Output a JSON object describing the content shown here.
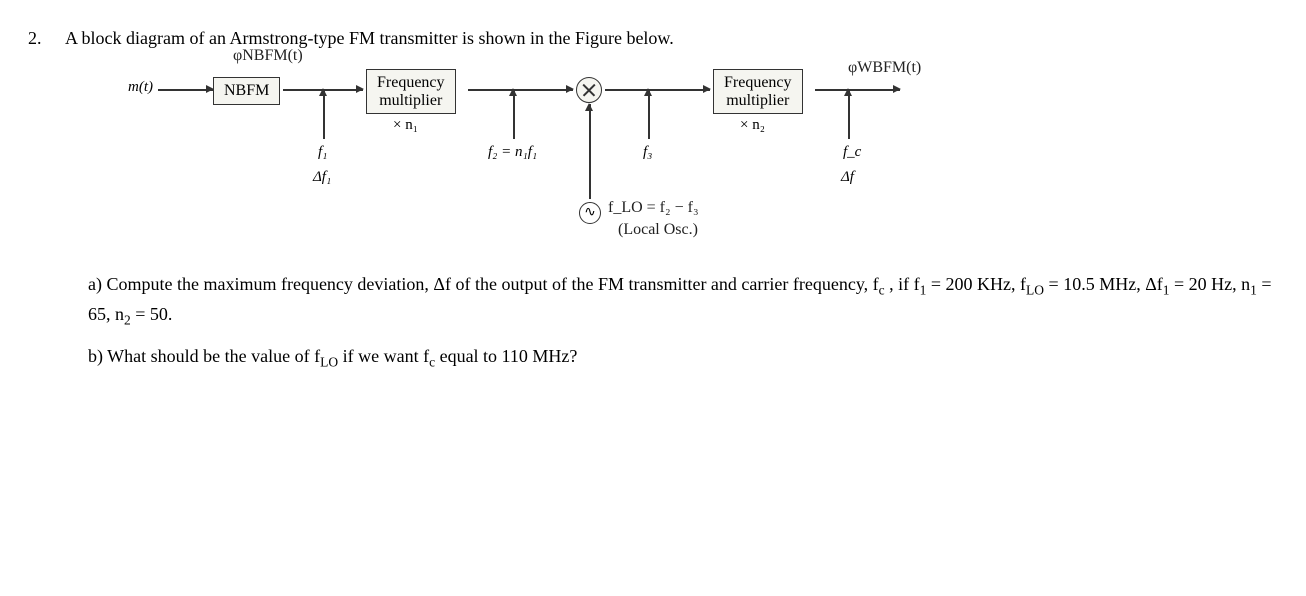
{
  "problem": {
    "number": "2.",
    "statement": "A block diagram of an Armstrong-type FM transmitter is shown in the Figure below."
  },
  "diagram": {
    "input": "m(t)",
    "block_nbfm": "NBFM",
    "hand_nbfm_out": "φNBFM(t)",
    "block_mult1": "Frequency multiplier",
    "mult1_factor": "× n₁",
    "f1": "f₁",
    "df1": "Δf₁",
    "f2": "f₂ = n₁f₁",
    "f3": "f₃",
    "block_mult2": "Frequency multiplier",
    "mult2_factor": "× n₂",
    "fc": "f_c",
    "df": "Δf",
    "hand_wbfm": "φWBFM(t)",
    "osc_sym": "∿",
    "hand_flo": "f_LO = f₂ − f₃",
    "hand_local_osc": "(Local Osc.)"
  },
  "parts": {
    "a_prefix": "a) Compute the maximum frequency deviation, Δf of the output of the FM transmitter and carrier frequency, f",
    "a_sub_c": "c",
    "a_mid1": " , if f",
    "a_sub_1a": "1",
    "a_mid2": " = 200 KHz, f",
    "a_sub_lo": "LO",
    "a_mid3": " = 10.5 MHz, Δf",
    "a_sub_1b": "1",
    "a_mid4": " = 20 Hz, n",
    "a_sub_n1": "1",
    "a_mid5": " = 65, n",
    "a_sub_n2": "2",
    "a_end": " = 50.",
    "b_prefix": "b) What should be the value of f",
    "b_sub_lo": "LO",
    "b_mid": " if we want f",
    "b_sub_c": "c",
    "b_end": " equal to 110 MHz?"
  }
}
